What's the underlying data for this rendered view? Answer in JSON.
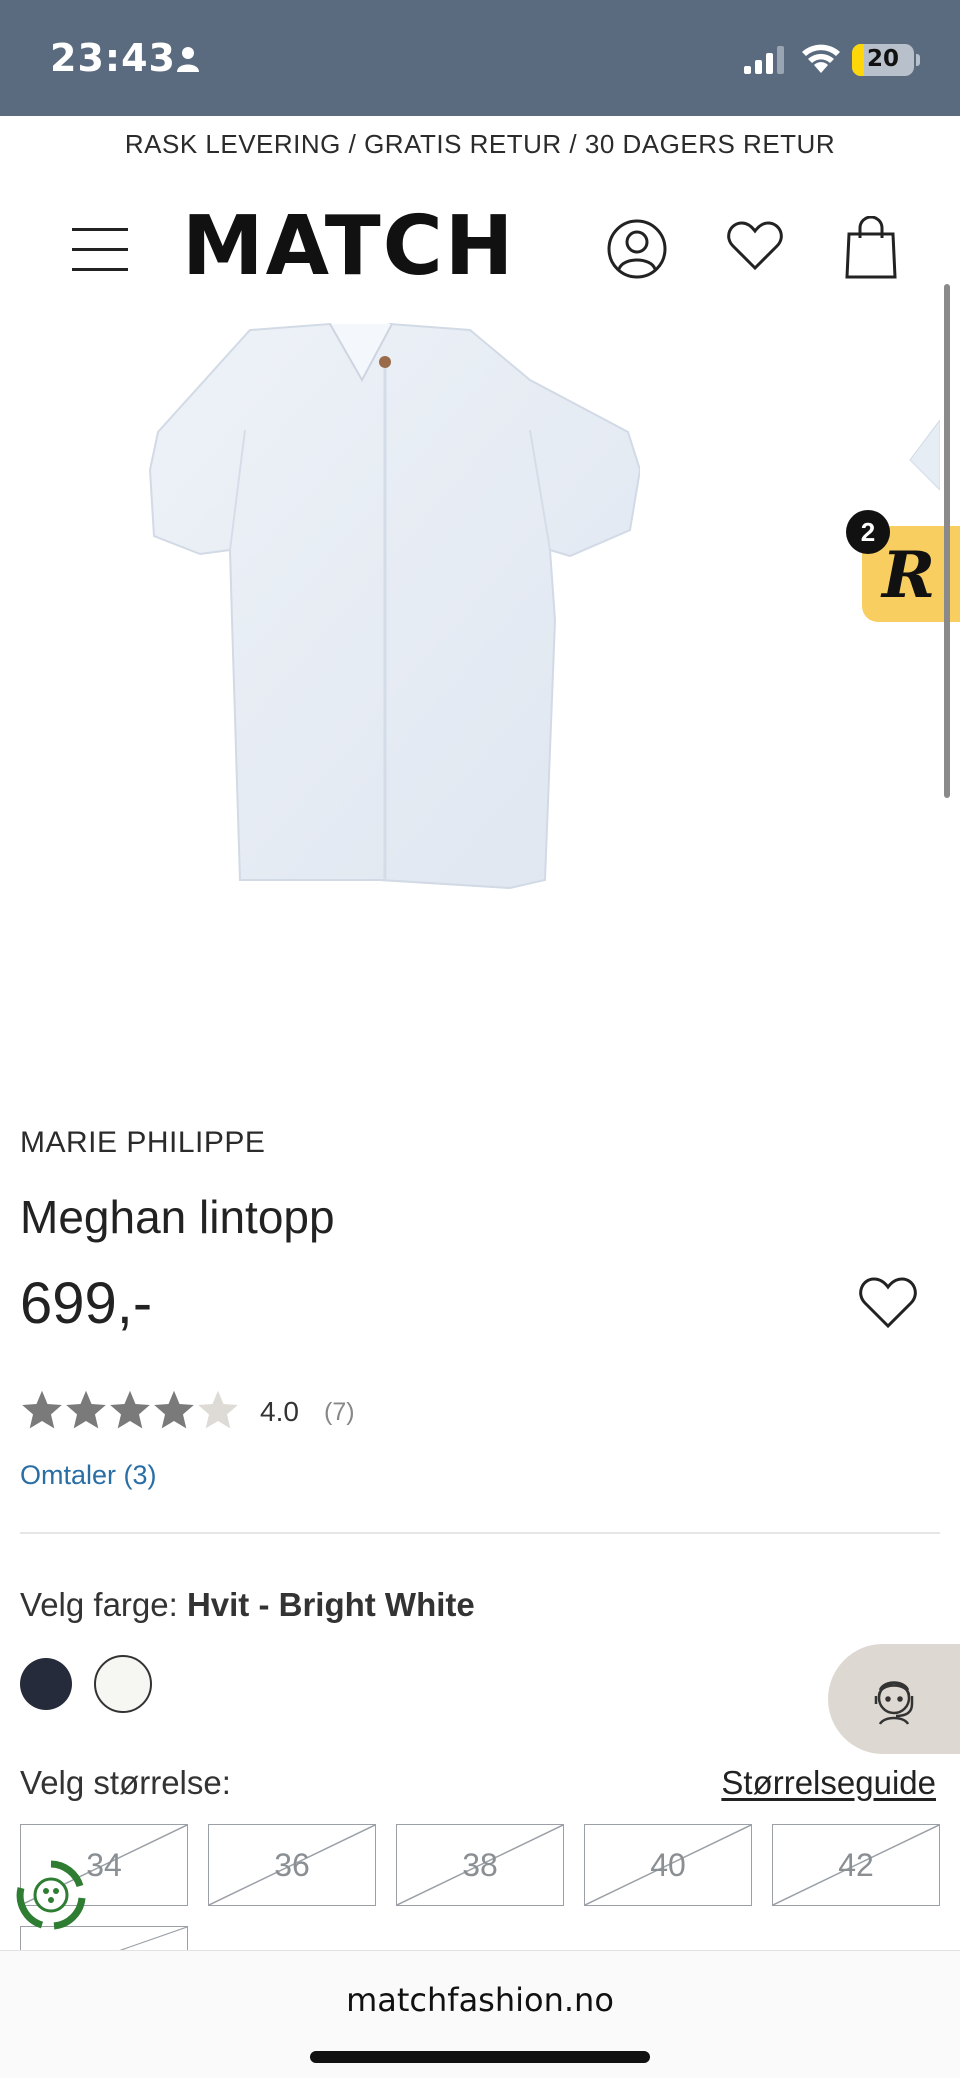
{
  "status_bar": {
    "time": "23:43",
    "battery_level": "20",
    "battery_fraction": 0.2,
    "icons": [
      "person-icon",
      "signal-icon",
      "wifi-icon",
      "battery-icon"
    ]
  },
  "promo_banner": "RASK LEVERING / GRATIS RETUR / 30 DAGERS RETUR",
  "header": {
    "logo": "MATCH",
    "icons": [
      "menu-icon",
      "account-icon",
      "wishlist-icon",
      "bag-icon"
    ]
  },
  "reviews_widget": {
    "badge_count": "2",
    "letter": "R"
  },
  "product": {
    "brand": "MARIE PHILIPPE",
    "name": "Meghan lintopp",
    "price": "699,-",
    "rating_value": "4.0",
    "rating_stars": 4,
    "rating_max": 5,
    "rating_count": "(7)",
    "reviews_link": "Omtaler (3)"
  },
  "color_picker": {
    "label": "Velg farge:",
    "selected": "Hvit - Bright White",
    "swatches": [
      {
        "name": "navy",
        "hex": "#252b3a"
      },
      {
        "name": "Hvit - Bright White",
        "hex": "#f6f6f2"
      }
    ]
  },
  "size_picker": {
    "label": "Velg størrelse:",
    "guide_link": "Størrelseguide",
    "sizes": [
      "34",
      "36",
      "38",
      "40",
      "42"
    ]
  },
  "browser": {
    "url": "matchfashion.no"
  },
  "colors": {
    "status_bar": "#5b6b7f",
    "link": "#2a6ea6",
    "reviews_tab": "#f8ce60",
    "battery": "#ffd60a"
  }
}
